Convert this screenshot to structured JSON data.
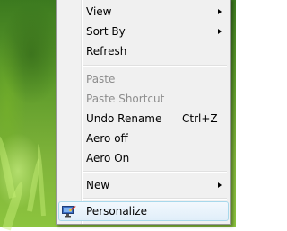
{
  "context_menu": {
    "items": [
      {
        "label": "View",
        "submenu": true,
        "disabled": false
      },
      {
        "label": "Sort By",
        "submenu": true,
        "disabled": false
      },
      {
        "label": "Refresh",
        "submenu": false,
        "disabled": false
      },
      {
        "label": "Paste",
        "submenu": false,
        "disabled": true
      },
      {
        "label": "Paste Shortcut",
        "submenu": false,
        "disabled": true
      },
      {
        "label": "Undo Rename",
        "shortcut": "Ctrl+Z",
        "submenu": false,
        "disabled": false
      },
      {
        "label": "Aero off",
        "submenu": false,
        "disabled": false
      },
      {
        "label": "Aero On",
        "submenu": false,
        "disabled": false
      },
      {
        "label": "New",
        "submenu": true,
        "disabled": false
      },
      {
        "label": "Personalize",
        "icon": "personalize-icon",
        "submenu": false,
        "disabled": false,
        "highlighted": true
      }
    ]
  },
  "colors": {
    "menu_background": "#f0f0f0",
    "disabled_text": "#8d8d8d",
    "highlight_border": "#a8d8eb",
    "desktop_green": "#6aa52f"
  }
}
